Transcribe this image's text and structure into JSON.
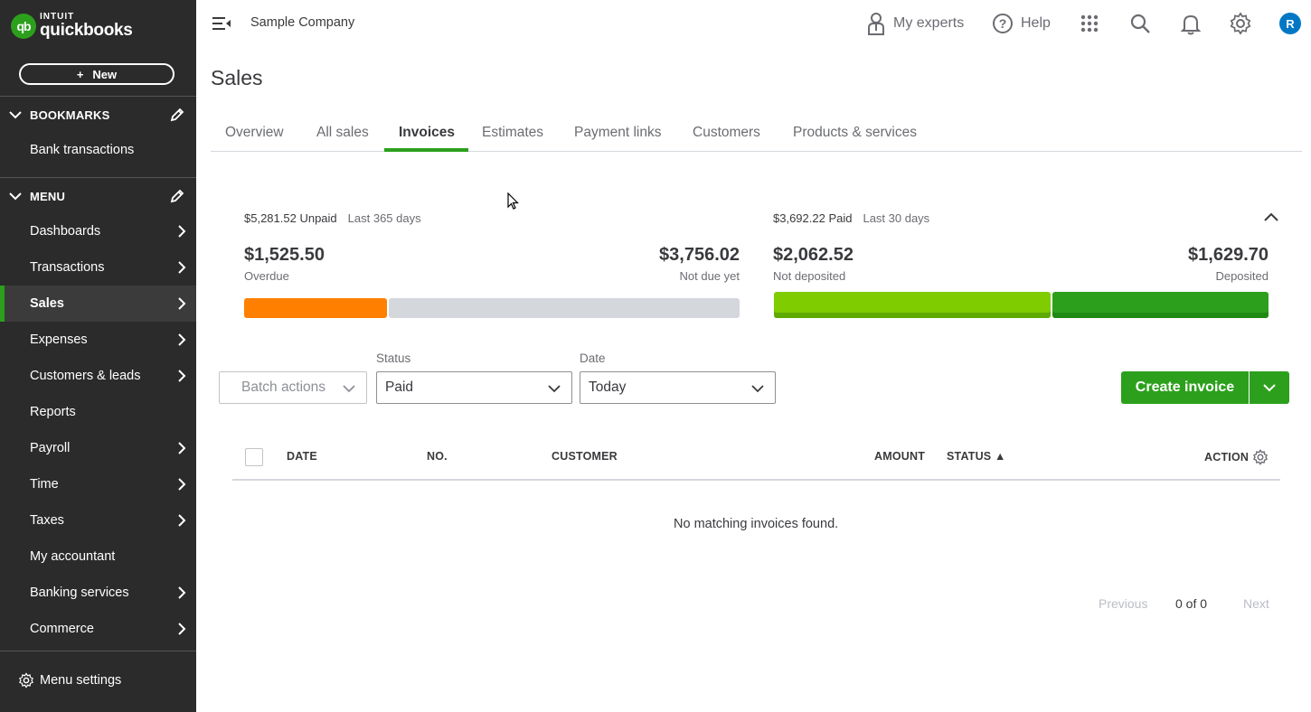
{
  "brand": {
    "logo_mark": "qb",
    "logo_small": "INTUIT",
    "logo_big": "quickbooks"
  },
  "sidebar": {
    "new_label": "New",
    "bookmarks_label": "BOOKMARKS",
    "bookmarks": [
      {
        "label": "Bank transactions"
      }
    ],
    "menu_label": "MENU",
    "menu_items": [
      {
        "label": "Dashboards",
        "has_arrow": true
      },
      {
        "label": "Transactions",
        "has_arrow": true
      },
      {
        "label": "Sales",
        "has_arrow": true,
        "active": true
      },
      {
        "label": "Expenses",
        "has_arrow": true
      },
      {
        "label": "Customers & leads",
        "has_arrow": true
      },
      {
        "label": "Reports",
        "has_arrow": false
      },
      {
        "label": "Payroll",
        "has_arrow": true
      },
      {
        "label": "Time",
        "has_arrow": true
      },
      {
        "label": "Taxes",
        "has_arrow": true
      },
      {
        "label": "My accountant",
        "has_arrow": false
      },
      {
        "label": "Banking services",
        "has_arrow": true
      },
      {
        "label": "Commerce",
        "has_arrow": true
      }
    ],
    "menu_settings_label": "Menu settings"
  },
  "topbar": {
    "company": "Sample Company",
    "my_experts": "My experts",
    "help": "Help",
    "avatar_initial": "R"
  },
  "page": {
    "title": "Sales",
    "tabs": [
      "Overview",
      "All sales",
      "Invoices",
      "Estimates",
      "Payment links",
      "Customers",
      "Products & services"
    ],
    "active_tab": "Invoices"
  },
  "summary": {
    "unpaid": {
      "total": "$5,281.52 Unpaid",
      "period": "Last 365 days",
      "overdue_amount": "$1,525.50",
      "overdue_label": "Overdue",
      "not_due_amount": "$3,756.02",
      "not_due_label": "Not due yet",
      "overdue_fraction": 0.289
    },
    "paid": {
      "total": "$3,692.22 Paid",
      "period": "Last 30 days",
      "not_deposited_amount": "$2,062.52",
      "not_deposited_label": "Not deposited",
      "deposited_amount": "$1,629.70",
      "deposited_label": "Deposited",
      "not_deposited_fraction": 0.559
    },
    "colors": {
      "overdue": "#ff8000",
      "not_due": "#d4d7dc",
      "not_deposited": "#7fcc00",
      "deposited": "#2ca01c"
    }
  },
  "filters": {
    "batch_actions": "Batch actions",
    "status_label": "Status",
    "status_value": "Paid",
    "date_label": "Date",
    "date_value": "Today",
    "create_invoice": "Create invoice"
  },
  "table": {
    "columns": {
      "date": "DATE",
      "no": "NO.",
      "customer": "CUSTOMER",
      "amount": "AMOUNT",
      "status": "STATUS ▲",
      "action": "ACTION"
    },
    "empty_message": "No matching invoices found."
  },
  "pagination": {
    "previous": "Previous",
    "count": "0 of 0",
    "next": "Next"
  }
}
